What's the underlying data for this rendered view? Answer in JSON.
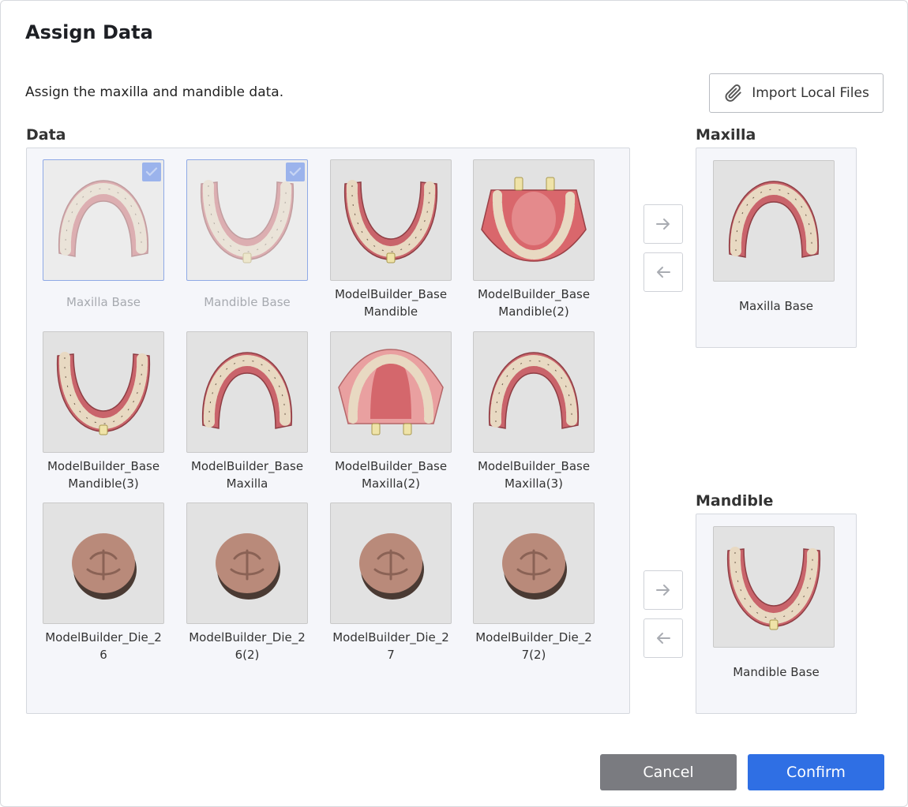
{
  "dialog": {
    "title": "Assign Data",
    "subtitle": "Assign the maxilla and mandible data.",
    "import_label": "Import Local Files"
  },
  "data_section": {
    "label": "Data",
    "items": [
      {
        "caption": "Maxilla Base",
        "assigned": true,
        "shape": "maxilla-arch"
      },
      {
        "caption": "Mandible Base",
        "assigned": true,
        "shape": "mandible-arch"
      },
      {
        "caption": "ModelBuilder_Base\nMandible",
        "assigned": false,
        "shape": "mandible-arch"
      },
      {
        "caption": "ModelBuilder_Base\nMandible(2)",
        "assigned": false,
        "shape": "mandible-base"
      },
      {
        "caption": "ModelBuilder_Base\nMandible(3)",
        "assigned": false,
        "shape": "mandible-arch"
      },
      {
        "caption": "ModelBuilder_Base\nMaxilla",
        "assigned": false,
        "shape": "maxilla-arch"
      },
      {
        "caption": "ModelBuilder_Base\nMaxilla(2)",
        "assigned": false,
        "shape": "maxilla-base"
      },
      {
        "caption": "ModelBuilder_Base\nMaxilla(3)",
        "assigned": false,
        "shape": "maxilla-arch"
      },
      {
        "caption": "ModelBuilder_Die_2\n6",
        "assigned": false,
        "shape": "tooth"
      },
      {
        "caption": "ModelBuilder_Die_2\n6(2)",
        "assigned": false,
        "shape": "tooth"
      },
      {
        "caption": "ModelBuilder_Die_2\n7",
        "assigned": false,
        "shape": "tooth"
      },
      {
        "caption": "ModelBuilder_Die_2\n7(2)",
        "assigned": false,
        "shape": "tooth"
      }
    ]
  },
  "maxilla": {
    "label": "Maxilla",
    "caption": "Maxilla Base"
  },
  "mandible": {
    "label": "Mandible",
    "caption": "Mandible Base"
  },
  "footer": {
    "cancel_label": "Cancel",
    "confirm_label": "Confirm"
  },
  "colors": {
    "accent": "#2f6fe4",
    "cancel": "#7a7b80",
    "check": "#9bb3ec"
  }
}
